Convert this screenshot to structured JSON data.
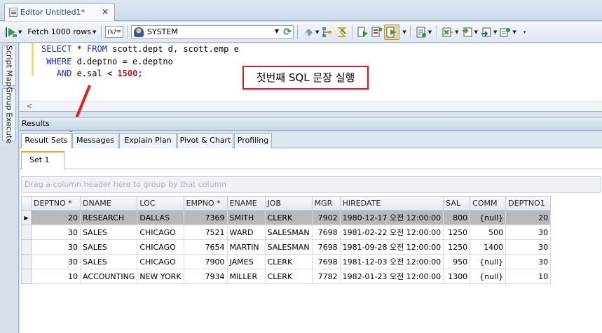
{
  "tab": {
    "title": "Editor Untitled1*",
    "close": "✕"
  },
  "toolbar": {
    "fetch_label": "Fetch 1000 rows",
    "xfx_label": "(x)=",
    "connection": "SYSTEM",
    "icons": [
      "run-icon",
      "fetch-dropdown-icon",
      "bind-variables-icon",
      "connection-icon",
      "refresh-icon",
      "erase-icon",
      "explain-plan-icon",
      "format-icon",
      "commit-icon",
      "rollback-icon",
      "execute-script-icon",
      "transaction-icon",
      "export-icon",
      "import-icon",
      "options-icon"
    ]
  },
  "sidebar": {
    "tabs": [
      "Script Map",
      "Group Execute"
    ]
  },
  "editor": {
    "lines": [
      [
        {
          "t": "SELECT",
          "c": "kw"
        },
        {
          "t": " * "
        },
        {
          "t": "FROM",
          "c": "kw"
        },
        {
          "t": " scott.dept d, scott.emp e"
        }
      ],
      [
        {
          "t": " "
        },
        {
          "t": "WHERE",
          "c": "kw"
        },
        {
          "t": " d.deptno = e.deptno"
        }
      ],
      [
        {
          "t": "   "
        },
        {
          "t": "AND",
          "c": "kw"
        },
        {
          "t": " e.sal < "
        },
        {
          "t": "1500",
          "c": "num"
        },
        {
          "t": ";"
        }
      ]
    ]
  },
  "annotation": {
    "text": "첫번째 SQL 문장 실행",
    "color": "#d81e1e"
  },
  "results": {
    "title": "Results",
    "tabs": [
      "Result Sets",
      "Messages",
      "Explain Plan",
      "Pivot & Chart",
      "Profiling"
    ],
    "active_tab": "Result Sets",
    "set_tab": "Set 1",
    "group_hint": "Drag a column header here to group by that column",
    "columns": [
      "DEPTNO *",
      "DNAME",
      "LOC",
      "EMPNO *",
      "ENAME",
      "JOB",
      "MGR",
      "HIREDATE",
      "SAL",
      "COMM",
      "DEPTNO1"
    ],
    "rows": [
      [
        "20",
        "RESEARCH",
        "DALLAS",
        "7369",
        "SMITH",
        "CLERK",
        "7902",
        "1980-12-17 오전 12:00:00",
        "800",
        "{null}",
        "20"
      ],
      [
        "30",
        "SALES",
        "CHICAGO",
        "7521",
        "WARD",
        "SALESMAN",
        "7698",
        "1981-02-22 오전 12:00:00",
        "1250",
        "500",
        "30"
      ],
      [
        "30",
        "SALES",
        "CHICAGO",
        "7654",
        "MARTIN",
        "SALESMAN",
        "7698",
        "1981-09-28 오전 12:00:00",
        "1250",
        "1400",
        "30"
      ],
      [
        "30",
        "SALES",
        "CHICAGO",
        "7900",
        "JAMES",
        "CLERK",
        "7698",
        "1981-12-03 오전 12:00:00",
        "950",
        "{null}",
        "30"
      ],
      [
        "10",
        "ACCOUNTING",
        "NEW YORK",
        "7934",
        "MILLER",
        "CLERK",
        "7782",
        "1982-01-23 오전 12:00:00",
        "1300",
        "{null}",
        "10"
      ]
    ],
    "selected_row": 0
  }
}
